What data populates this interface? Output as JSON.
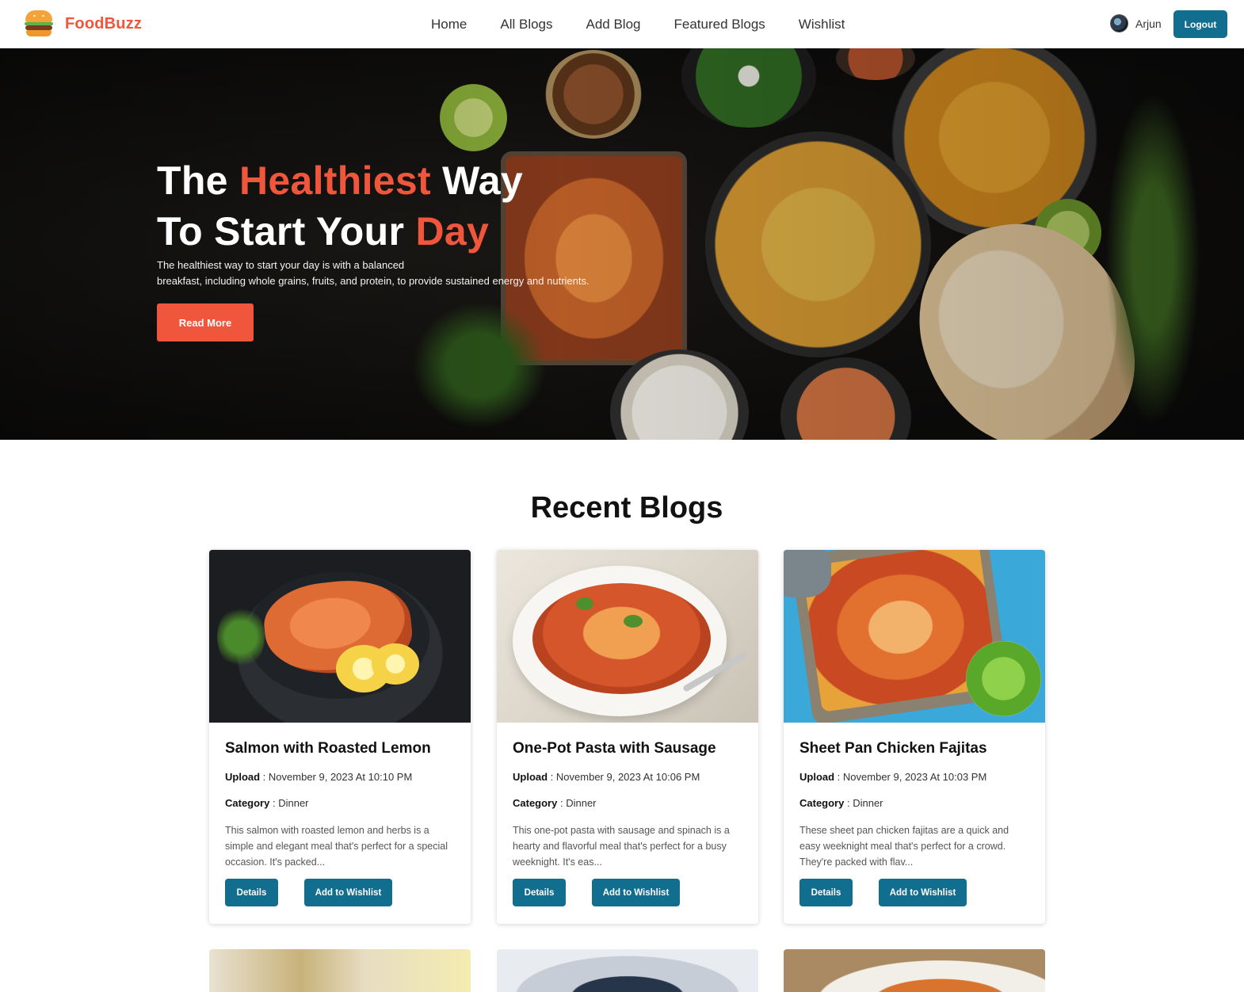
{
  "brand": {
    "name": "FoodBuzz",
    "logo_icon": "burger-icon"
  },
  "nav": {
    "links": [
      "Home",
      "All Blogs",
      "Add Blog",
      "Featured Blogs",
      "Wishlist"
    ]
  },
  "user": {
    "name": "Arjun",
    "logout_label": "Logout"
  },
  "hero": {
    "title_line1_pre": "The ",
    "title_line1_hl": "Healthiest",
    "title_line1_post": " Way",
    "title_line2_pre": "To Start Your ",
    "title_line2_hl": "Day",
    "desc_line1": "The healthiest way to start your day is with a balanced",
    "desc_line2": "breakfast, including whole grains, fruits, and protein, to provide sustained energy and nutrients.",
    "cta_label": "Read More"
  },
  "recent": {
    "title": "Recent Blogs",
    "upload_label": "Upload",
    "category_label": "Category",
    "details_label": "Details",
    "wishlist_label": "Add to Wishlist",
    "cards": [
      {
        "title": "Salmon with Roasted Lemon",
        "upload": "November 9, 2023 At 10:10 PM",
        "category": "Dinner",
        "excerpt": "This salmon with roasted lemon and herbs is a simple and elegant meal that's perfect for a special occasion. It's packed..."
      },
      {
        "title": "One-Pot Pasta with Sausage",
        "upload": "November 9, 2023 At 10:06 PM",
        "category": "Dinner",
        "excerpt": "This one-pot pasta with sausage and spinach is a hearty and flavorful meal that's perfect for a busy weeknight. It's eas..."
      },
      {
        "title": "Sheet Pan Chicken Fajitas",
        "upload": "November 9, 2023 At 10:03 PM",
        "category": "Dinner",
        "excerpt": "These sheet pan chicken fajitas are a quick and easy weeknight meal that's perfect for a crowd. They're packed with flav..."
      }
    ]
  },
  "colors": {
    "accent": "#f0563b",
    "primary": "#126e8f",
    "hero_bg": "#0e0d0c"
  }
}
